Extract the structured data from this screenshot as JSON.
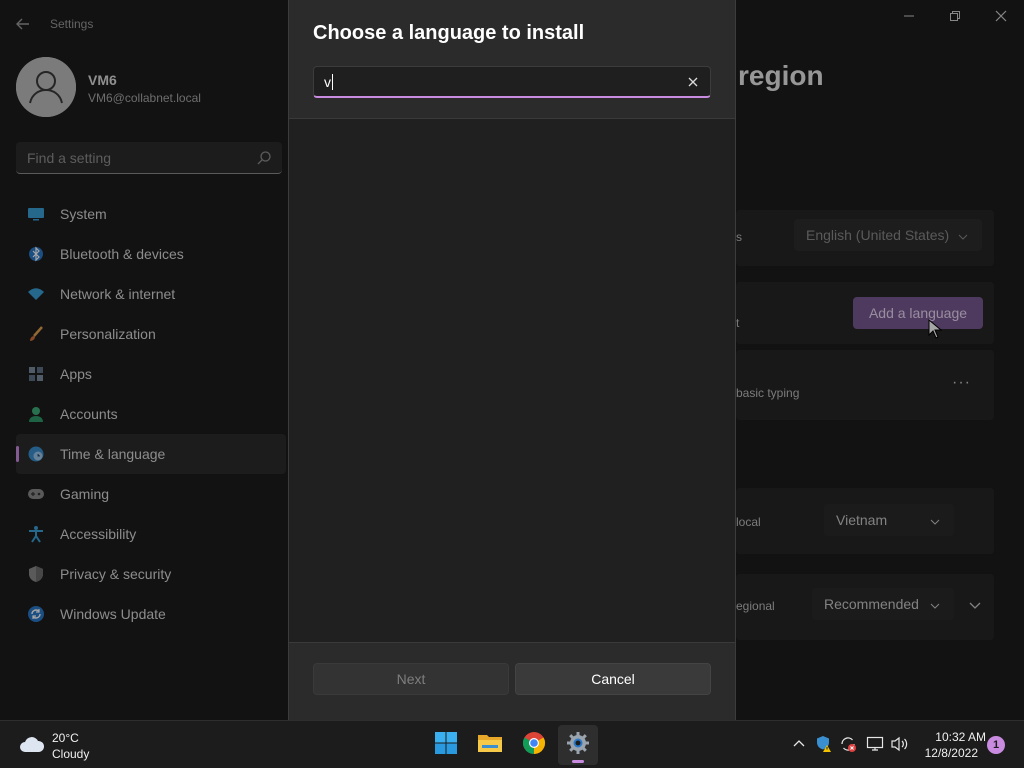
{
  "settings": {
    "title": "Settings",
    "user": {
      "name": "VM6",
      "email": "VM6@collabnet.local"
    },
    "search_placeholder": "Find a setting",
    "nav": [
      {
        "label": "System",
        "icon": "monitor-icon",
        "active": false
      },
      {
        "label": "Bluetooth & devices",
        "icon": "bluetooth-icon",
        "active": false
      },
      {
        "label": "Network & internet",
        "icon": "wifi-icon",
        "active": false
      },
      {
        "label": "Personalization",
        "icon": "brush-icon",
        "active": false
      },
      {
        "label": "Apps",
        "icon": "apps-icon",
        "active": false
      },
      {
        "label": "Accounts",
        "icon": "person-icon",
        "active": false
      },
      {
        "label": "Time & language",
        "icon": "globe-clock-icon",
        "active": true
      },
      {
        "label": "Gaming",
        "icon": "gamepad-icon",
        "active": false
      },
      {
        "label": "Accessibility",
        "icon": "accessibility-icon",
        "active": false
      },
      {
        "label": "Privacy & security",
        "icon": "shield-icon",
        "active": false
      },
      {
        "label": "Windows Update",
        "icon": "update-icon",
        "active": false
      }
    ],
    "page_title_partial": "region",
    "windows_display_language": "English (United States)",
    "row_fragments": {
      "display_lang": "s",
      "preferred": "t",
      "basic_typing": "basic typing",
      "country": "local",
      "regional": "egional"
    },
    "add_language_label": "Add a language",
    "more_label": "···",
    "country_value": "Vietnam",
    "regional_format_value": "Recommended"
  },
  "dialog": {
    "title": "Choose a language to install",
    "search_value": "v",
    "next_label": "Next",
    "cancel_label": "Cancel"
  },
  "taskbar": {
    "weather_temp": "20°C",
    "weather_condition": "Cloudy",
    "time": "10:32 AM",
    "date": "12/8/2022",
    "notification_count": "1",
    "apps": [
      "start-icon",
      "file-explorer-icon",
      "chrome-icon",
      "settings-icon"
    ]
  },
  "colors": {
    "accent": "#c98be0",
    "add_language_bg": "#7a5a92"
  }
}
